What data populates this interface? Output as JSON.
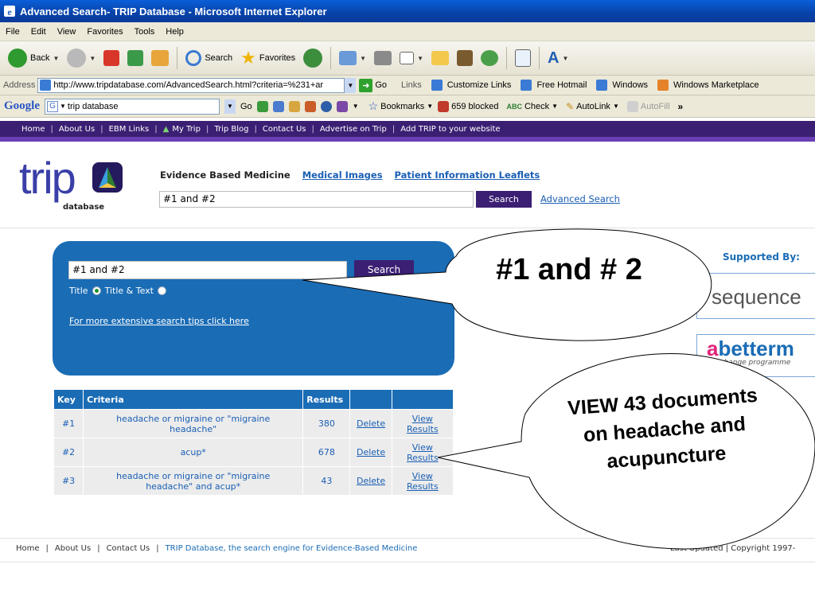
{
  "window": {
    "title": "Advanced Search- TRIP Database - Microsoft Internet Explorer"
  },
  "menu": [
    "File",
    "Edit",
    "View",
    "Favorites",
    "Tools",
    "Help"
  ],
  "toolbar": {
    "back": "Back",
    "search": "Search",
    "favorites": "Favorites"
  },
  "address": {
    "label": "Address",
    "url": "http://www.tripdatabase.com/AdvancedSearch.html?criteria=%231+ar",
    "go": "Go",
    "links_label": "Links",
    "links": [
      "Customize Links",
      "Free Hotmail",
      "Windows",
      "Windows Marketplace"
    ]
  },
  "googlebar": {
    "logo": "Google",
    "query": "trip database",
    "go": "Go",
    "bookmarks": "Bookmarks",
    "blocked": "659 blocked",
    "check": "Check",
    "autolink": "AutoLink",
    "autofill": "AutoFill"
  },
  "sitenav": [
    "Home",
    "About Us",
    "EBM Links",
    "My Trip",
    "Trip Blog",
    "Contact Us",
    "Advertise on Trip",
    "Add TRIP to your website"
  ],
  "logo": {
    "trip": "trip",
    "database": "database"
  },
  "header": {
    "evidence": "Evidence Based Medicine",
    "medical_images": "Medical Images",
    "patient_leaflets": "Patient Information Leaflets",
    "search_value": "#1 and #2",
    "search_button": "Search",
    "advanced_link": "Advanced Search"
  },
  "panel": {
    "search_value": "#1 and #2",
    "search_button": "Search",
    "radio_title": "Title",
    "radio_title_text": "Title & Text",
    "tips_link": "For more extensive search tips click here"
  },
  "table": {
    "headers": [
      "Key",
      "Criteria",
      "Results",
      "",
      ""
    ],
    "rows": [
      {
        "key": "#1",
        "criteria": "headache or migraine or \"migraine headache\"",
        "results": "380",
        "delete": "Delete",
        "view": "View Results"
      },
      {
        "key": "#2",
        "criteria": "acup*",
        "results": "678",
        "delete": "Delete",
        "view": "View Results"
      },
      {
        "key": "#3",
        "criteria": "headache or migraine or \"migraine headache\" and acup*",
        "results": "43",
        "delete": "Delete",
        "view": "View Results"
      }
    ]
  },
  "sponsors": {
    "label": "Supported By:",
    "s1": "sequence",
    "s2_a": "a",
    "s2_rest": "betterm",
    "s2_sub": "life change programme"
  },
  "footer": {
    "home": "Home",
    "about": "About Us",
    "contact": "Contact Us",
    "tagline": "TRIP Database, the search engine for Evidence-Based Medicine",
    "right": "Last Updated  |  Copyright 1997-"
  },
  "callouts": {
    "one": "#1 and # 2",
    "two": "VIEW 43 documents on headache and acupuncture"
  }
}
